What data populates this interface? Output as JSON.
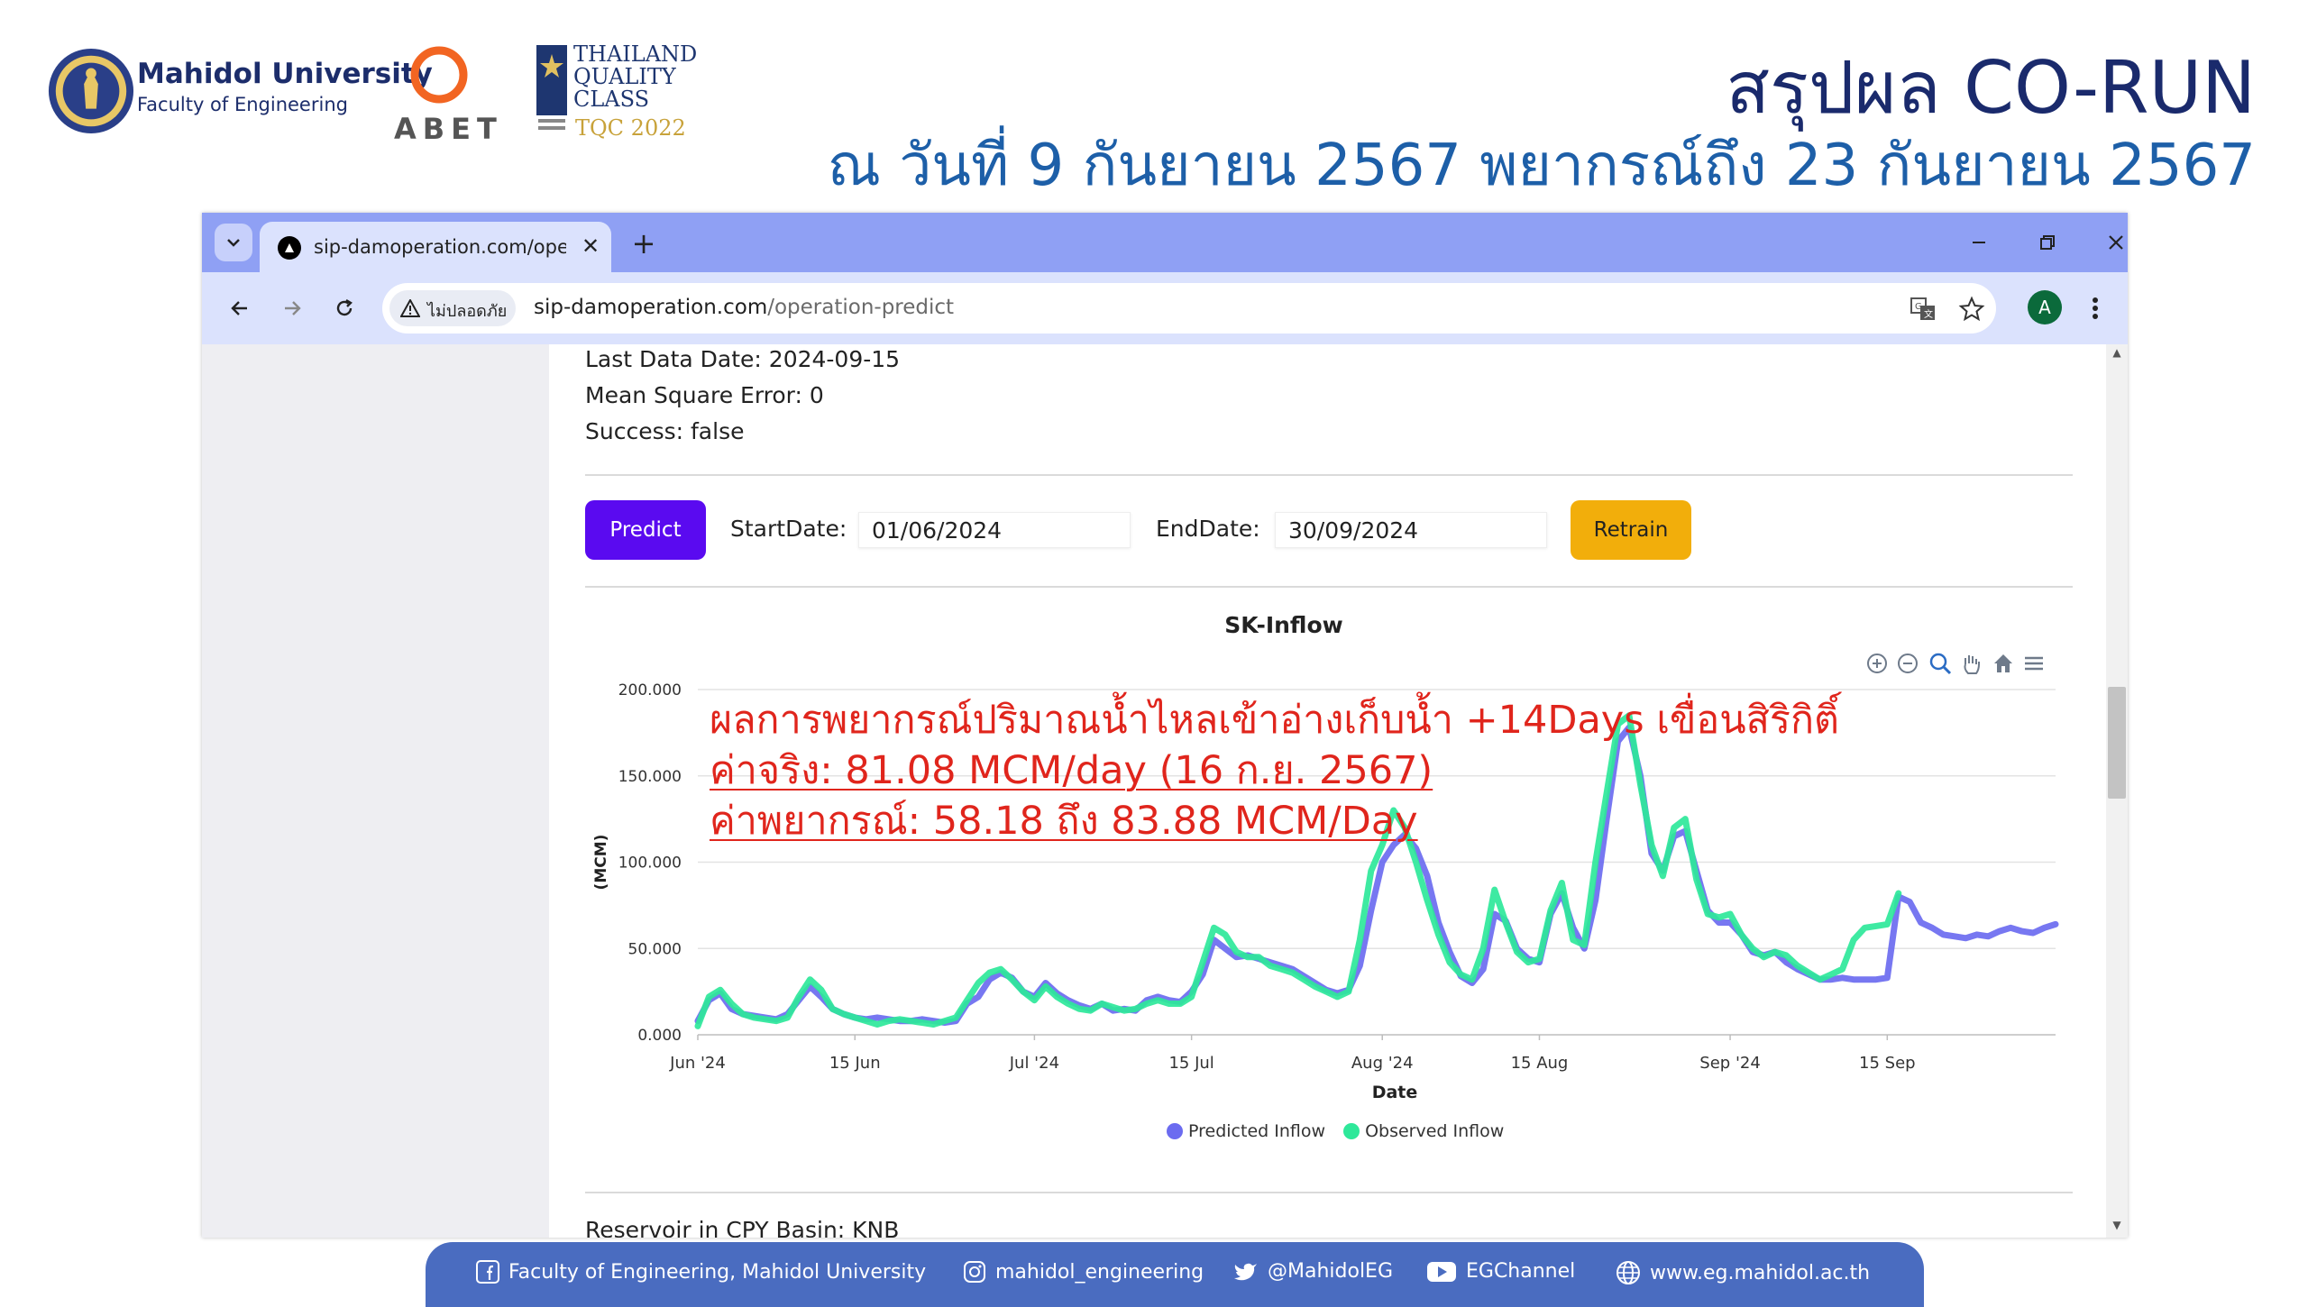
{
  "slide": {
    "university": "Mahidol University",
    "faculty": "Faculty of Engineering",
    "abet": "ABET",
    "tqc_name_line1": "THAILAND",
    "tqc_name_line2": "QUALITY",
    "tqc_name_line3": "CLASS",
    "tqc_year": "TQC 2022",
    "title": "สรุปผล CO-RUN",
    "subtitle": "ณ วันที่ 9 กันยายน 2567 พยากรณ์ถึง 23 กันยายน 2567"
  },
  "browser": {
    "tab_title": "sip-damoperation.com/operati",
    "security_label": "ไม่ปลอดภัย",
    "url_domain": "sip-damoperation.com",
    "url_path": "/operation-predict",
    "profile_initial": "A"
  },
  "page": {
    "last_data_date": "Last Data Date: 2024-09-15",
    "mse": "Mean Square Error: 0",
    "success": "Success: false",
    "predict_label": "Predict",
    "start_label": "StartDate:",
    "start_value": "01/06/2024",
    "end_label": "EndDate:",
    "end_value": "30/09/2024",
    "retrain_label": "Retrain",
    "bottom_text": "Reservoir in CPY Basin: KNB"
  },
  "annotation": {
    "line1": "ผลการพยากรณ์ปริมาณน้ำไหลเข้าอ่างเก็บน้ำ +14Days เขื่อนสิริกิติ์",
    "line2": "ค่าจริง: 81.08 MCM/day (16 ก.ย. 2567)",
    "line3": "ค่าพยากรณ์: 58.18 ถึง 83.88 MCM/Day"
  },
  "footer": {
    "facebook": "Faculty of Engineering, Mahidol University",
    "instagram": "mahidol_engineering",
    "twitter": "@MahidolEG",
    "youtube": "EGChannel",
    "website": "www.eg.mahidol.ac.th"
  },
  "colors": {
    "predicted": "#6b6bf0",
    "observed": "#2ee89a",
    "predict_button": "#5a0af0",
    "retrain_button": "#f2ae0b",
    "annotation": "#e0251c",
    "tabbar": "#8fa0f4",
    "footer": "#4a6cc0"
  },
  "chart_data": {
    "type": "line",
    "title": "SK-Inflow",
    "xlabel": "Date",
    "ylabel": "(MCM)",
    "ylim": [
      0,
      200
    ],
    "yticks": [
      "0.000",
      "50.000",
      "100.000",
      "150.000",
      "200.000"
    ],
    "x_start": "2024-06-01",
    "xticks": [
      {
        "label": "Jun '24",
        "day": 0
      },
      {
        "label": "15 Jun",
        "day": 14
      },
      {
        "label": "Jul '24",
        "day": 30
      },
      {
        "label": "15 Jul",
        "day": 44
      },
      {
        "label": "Aug '24",
        "day": 61
      },
      {
        "label": "15 Aug",
        "day": 75
      },
      {
        "label": "Sep '24",
        "day": 92
      },
      {
        "label": "15 Sep",
        "day": 106
      }
    ],
    "grid": true,
    "legend_position": "bottom-center",
    "series": [
      {
        "name": "Predicted Inflow",
        "color": "#6b6bf0",
        "x": [
          0,
          1,
          2,
          3,
          4,
          5,
          6,
          7,
          8,
          9,
          10,
          11,
          12,
          13,
          14,
          15,
          16,
          17,
          18,
          19,
          20,
          21,
          22,
          23,
          24,
          25,
          26,
          27,
          28,
          29,
          30,
          31,
          32,
          33,
          34,
          35,
          36,
          37,
          38,
          39,
          40,
          41,
          42,
          43,
          44,
          45,
          46,
          47,
          48,
          49,
          50,
          51,
          52,
          53,
          54,
          55,
          56,
          57,
          58,
          59,
          60,
          61,
          62,
          63,
          64,
          65,
          66,
          67,
          68,
          69,
          70,
          71,
          72,
          73,
          74,
          75,
          76,
          77,
          78,
          79,
          80,
          81,
          82,
          83,
          84,
          85,
          86,
          87,
          88,
          89,
          90,
          91,
          92,
          93,
          94,
          95,
          96,
          97,
          98,
          99,
          100,
          101,
          102,
          103,
          104,
          105,
          106,
          107,
          108,
          109,
          110,
          111,
          112,
          113,
          114,
          115,
          116,
          117,
          118,
          119,
          120,
          121
        ],
        "y": [
          8,
          20,
          24,
          15,
          12,
          11,
          10,
          9,
          12,
          20,
          28,
          22,
          15,
          12,
          10,
          9,
          10,
          9,
          8,
          8,
          9,
          8,
          7,
          8,
          18,
          22,
          32,
          36,
          33,
          25,
          22,
          30,
          24,
          20,
          17,
          15,
          18,
          14,
          15,
          14,
          20,
          22,
          20,
          19,
          25,
          35,
          55,
          50,
          45,
          46,
          44,
          42,
          40,
          38,
          34,
          30,
          26,
          24,
          26,
          40,
          72,
          100,
          110,
          116,
          108,
          92,
          65,
          48,
          34,
          30,
          38,
          70,
          66,
          50,
          44,
          42,
          70,
          82,
          62,
          50,
          78,
          125,
          170,
          178,
          150,
          105,
          95,
          115,
          118,
          95,
          72,
          65,
          65,
          58,
          48,
          46,
          48,
          42,
          38,
          35,
          32,
          32,
          33,
          32,
          32,
          32,
          33,
          80,
          77,
          65,
          62,
          58,
          57,
          56,
          58,
          57,
          60,
          62,
          60,
          59,
          62,
          64
        ]
      },
      {
        "name": "Observed Inflow",
        "color": "#2ee89a",
        "x": [
          0,
          1,
          2,
          3,
          4,
          5,
          6,
          7,
          8,
          9,
          10,
          11,
          12,
          13,
          14,
          15,
          16,
          17,
          18,
          19,
          20,
          21,
          22,
          23,
          24,
          25,
          26,
          27,
          28,
          29,
          30,
          31,
          32,
          33,
          34,
          35,
          36,
          37,
          38,
          39,
          40,
          41,
          42,
          43,
          44,
          45,
          46,
          47,
          48,
          49,
          50,
          51,
          52,
          53,
          54,
          55,
          56,
          57,
          58,
          59,
          60,
          61,
          62,
          63,
          64,
          65,
          66,
          67,
          68,
          69,
          70,
          71,
          72,
          73,
          74,
          75,
          76,
          77,
          78,
          79,
          80,
          81,
          82,
          83,
          84,
          85,
          86,
          87,
          88,
          89,
          90,
          91,
          92,
          93,
          94,
          95,
          96,
          97,
          98,
          99,
          100,
          101,
          102,
          103,
          104,
          105,
          106,
          107
        ],
        "y": [
          5,
          22,
          26,
          18,
          12,
          10,
          9,
          8,
          10,
          22,
          32,
          26,
          15,
          12,
          10,
          8,
          6,
          8,
          9,
          8,
          7,
          6,
          8,
          10,
          20,
          30,
          36,
          38,
          32,
          25,
          20,
          28,
          22,
          18,
          15,
          14,
          18,
          16,
          14,
          15,
          18,
          20,
          18,
          18,
          22,
          42,
          62,
          58,
          48,
          45,
          45,
          40,
          38,
          36,
          32,
          28,
          25,
          22,
          25,
          55,
          95,
          110,
          130,
          120,
          100,
          78,
          58,
          42,
          35,
          32,
          50,
          84,
          65,
          48,
          42,
          44,
          72,
          88,
          55,
          52,
          100,
          140,
          180,
          185,
          145,
          110,
          92,
          120,
          125,
          90,
          70,
          68,
          70,
          58,
          50,
          45,
          48,
          46,
          40,
          36,
          32,
          35,
          38,
          55,
          62,
          63,
          64,
          82
        ]
      }
    ]
  }
}
